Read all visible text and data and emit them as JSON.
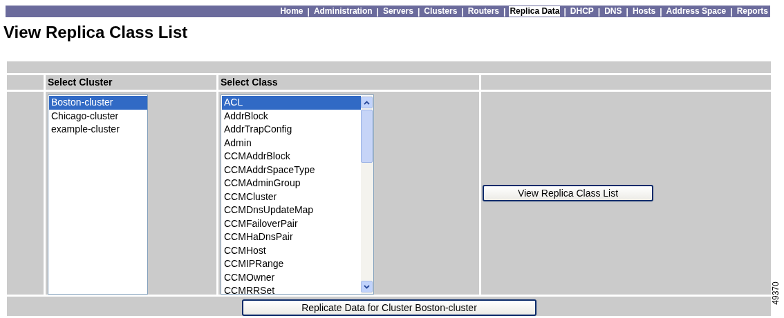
{
  "nav": [
    {
      "label": "Home",
      "selected": false
    },
    {
      "label": "Administration",
      "selected": false
    },
    {
      "label": "Servers",
      "selected": false
    },
    {
      "label": "Clusters",
      "selected": false
    },
    {
      "label": "Routers",
      "selected": false
    },
    {
      "label": "Replica Data",
      "selected": true
    },
    {
      "label": "DHCP",
      "selected": false
    },
    {
      "label": "DNS",
      "selected": false
    },
    {
      "label": "Hosts",
      "selected": false
    },
    {
      "label": "Address Space",
      "selected": false
    },
    {
      "label": "Reports",
      "selected": false
    }
  ],
  "nav_separator": "|",
  "page_title": "View Replica Class List",
  "cluster_heading": "Select Cluster",
  "clusters": [
    {
      "label": "Boston-cluster",
      "selected": true
    },
    {
      "label": "Chicago-cluster",
      "selected": false
    },
    {
      "label": "example-cluster",
      "selected": false
    }
  ],
  "class_heading": "Select Class",
  "classes": [
    {
      "label": "ACL",
      "selected": true
    },
    {
      "label": "AddrBlock",
      "selected": false
    },
    {
      "label": "AddrTrapConfig",
      "selected": false
    },
    {
      "label": "Admin",
      "selected": false
    },
    {
      "label": "CCMAddrBlock",
      "selected": false
    },
    {
      "label": "CCMAddrSpaceType",
      "selected": false
    },
    {
      "label": "CCMAdminGroup",
      "selected": false
    },
    {
      "label": "CCMCluster",
      "selected": false
    },
    {
      "label": "CCMDnsUpdateMap",
      "selected": false
    },
    {
      "label": "CCMFailoverPair",
      "selected": false
    },
    {
      "label": "CCMHaDnsPair",
      "selected": false
    },
    {
      "label": "CCMHost",
      "selected": false
    },
    {
      "label": "CCMIPRange",
      "selected": false
    },
    {
      "label": "CCMOwner",
      "selected": false
    },
    {
      "label": "CCMRRSet",
      "selected": false
    }
  ],
  "view_button": "View Replica Class List",
  "replicate_button": "Replicate Data for Cluster Boston-cluster",
  "figure_number": "49370"
}
